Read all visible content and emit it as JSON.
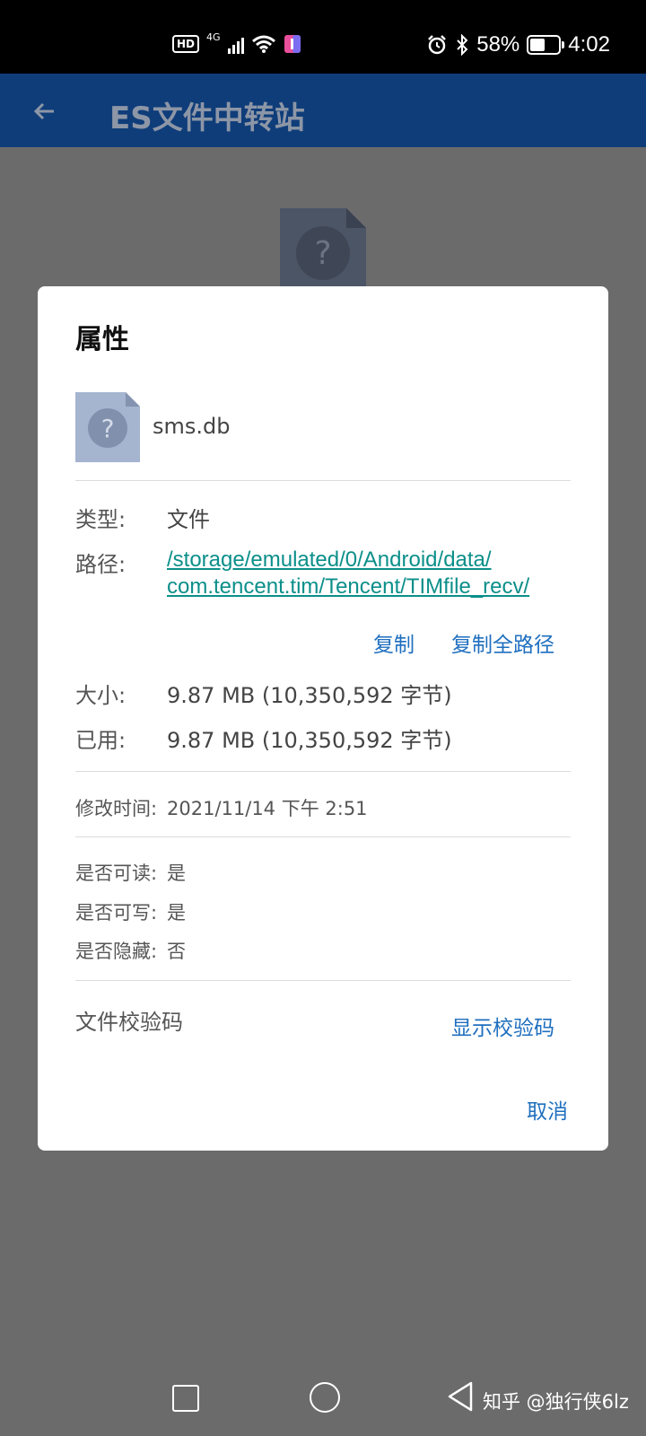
{
  "status_bar": {
    "network_hd": "HD",
    "network_gen": "4G",
    "battery_percent": "58%",
    "time": "4:02",
    "icons": [
      "alarm-icon",
      "bluetooth-icon",
      "wifi-icon",
      "signal-icon",
      "notification-app-icon"
    ]
  },
  "app_bar": {
    "title": "ES文件中转站"
  },
  "dialog": {
    "title": "属性",
    "file_name": "sms.db",
    "type_label": "类型:",
    "type_value": "文件",
    "path_label": "路径:",
    "path_line1": "/storage/emulated/0/Android/data/",
    "path_line2": "com.tencent.tim/Tencent/TIMfile_recv/",
    "copy_label": "复制",
    "copy_full_path_label": "复制全路径",
    "size_label": "大小:",
    "size_value": "9.87 MB (10,350,592 字节)",
    "used_label": "已用:",
    "used_value": "9.87 MB (10,350,592 字节)",
    "modified_label": "修改时间:",
    "modified_value": "2021/11/14 下午 2:51",
    "readable_label": "是否可读:",
    "readable_value": "是",
    "writable_label": "是否可写:",
    "writable_value": "是",
    "hidden_label": "是否隐藏:",
    "hidden_value": "否",
    "checksum_label": "文件校验码",
    "show_checksum_label": "显示校验码",
    "cancel_label": "取消"
  },
  "nav_bar": {
    "watermark": "知乎 @独行侠6lz"
  },
  "colors": {
    "app_bar": "#0f3d7a",
    "link": "#0c8f8a",
    "action": "#1f6fbf",
    "scrim": "#6b6b6b"
  }
}
